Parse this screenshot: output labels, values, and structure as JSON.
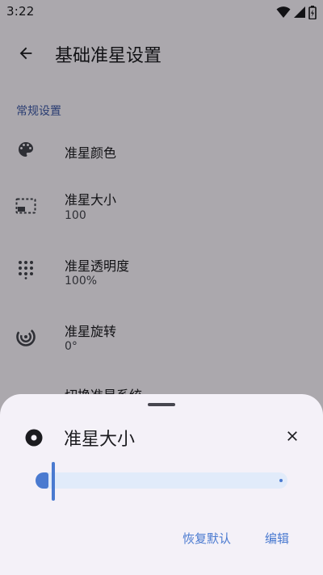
{
  "status_bar": {
    "time": "3:22",
    "icons": [
      "wifi-icon",
      "signal-icon",
      "battery-icon"
    ]
  },
  "app_bar": {
    "back_icon": "arrow-back-icon",
    "title": "基础准星设置"
  },
  "settings": {
    "section_header": "常规设置",
    "items": [
      {
        "icon": "palette-icon",
        "title": "准星颜色",
        "summary": ""
      },
      {
        "icon": "picture-in-picture-icon",
        "title": "准星大小",
        "summary": "100"
      },
      {
        "icon": "dot-grid-icon",
        "title": "准星透明度",
        "summary": "100%"
      },
      {
        "icon": "rotation-icon",
        "title": "准星旋转",
        "summary": "0°"
      },
      {
        "icon": "",
        "title": "切换准星系统",
        "summary": ""
      }
    ]
  },
  "sheet": {
    "icon": "target-dot-icon",
    "title": "准星大小",
    "close_icon": "close-icon",
    "slider": {
      "value": 100,
      "fraction": 0.07
    },
    "actions": {
      "reset_label": "恢复默认",
      "edit_label": "编辑"
    }
  },
  "colors": {
    "accent": "#4a7ad0",
    "section_header": "#3f5aa9",
    "slider_track": "#e1ebfa",
    "sheet_bg": "#f4f1f8",
    "scrim": "rgba(0,0,0,0.32)"
  }
}
